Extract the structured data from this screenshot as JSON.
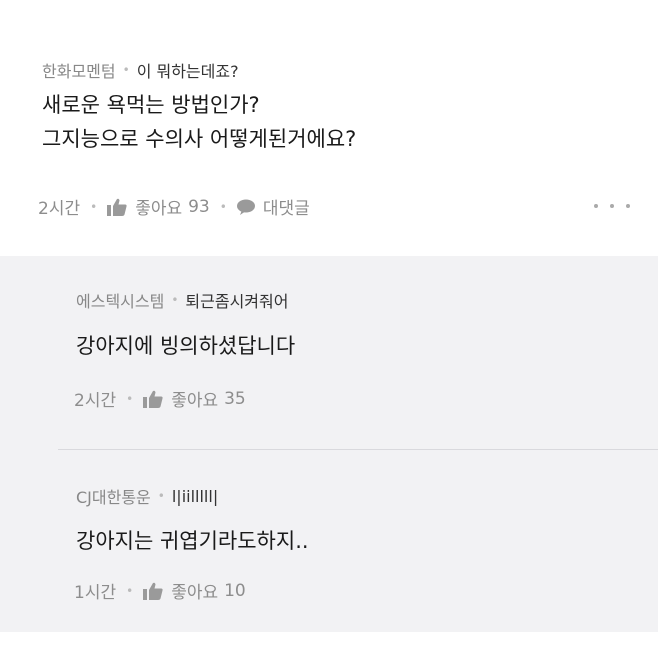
{
  "main_comment": {
    "author": "한화모멘텀",
    "user_id": "이 뭐하는데죠?",
    "lines": [
      "새로운 욕먹는 방법인가?",
      "그지능으로 수의사 어떻게된거에요?"
    ],
    "time": "2시간",
    "like_label": "좋아요",
    "like_count": "93",
    "reply_label": "대댓글"
  },
  "replies": [
    {
      "author": "에스텍시스템",
      "user_id": "퇴근좀시켜줘어",
      "text": "강아지에 빙의하셨답니다",
      "time": "2시간",
      "like_label": "좋아요",
      "like_count": "35"
    },
    {
      "author": "CJ대한통운",
      "user_id": "l|iilllll|",
      "text": "강아지는 귀엽기라도하지..",
      "time": "1시간",
      "like_label": "좋아요",
      "like_count": "10"
    }
  ],
  "icons": {
    "like": "thumbs-up-icon",
    "reply": "speech-bubble-icon",
    "more": "more-dots-icon"
  },
  "colors": {
    "reply_background": "#f2f2f4",
    "meta_text": "#888888",
    "body_text": "#1a1a1a"
  }
}
